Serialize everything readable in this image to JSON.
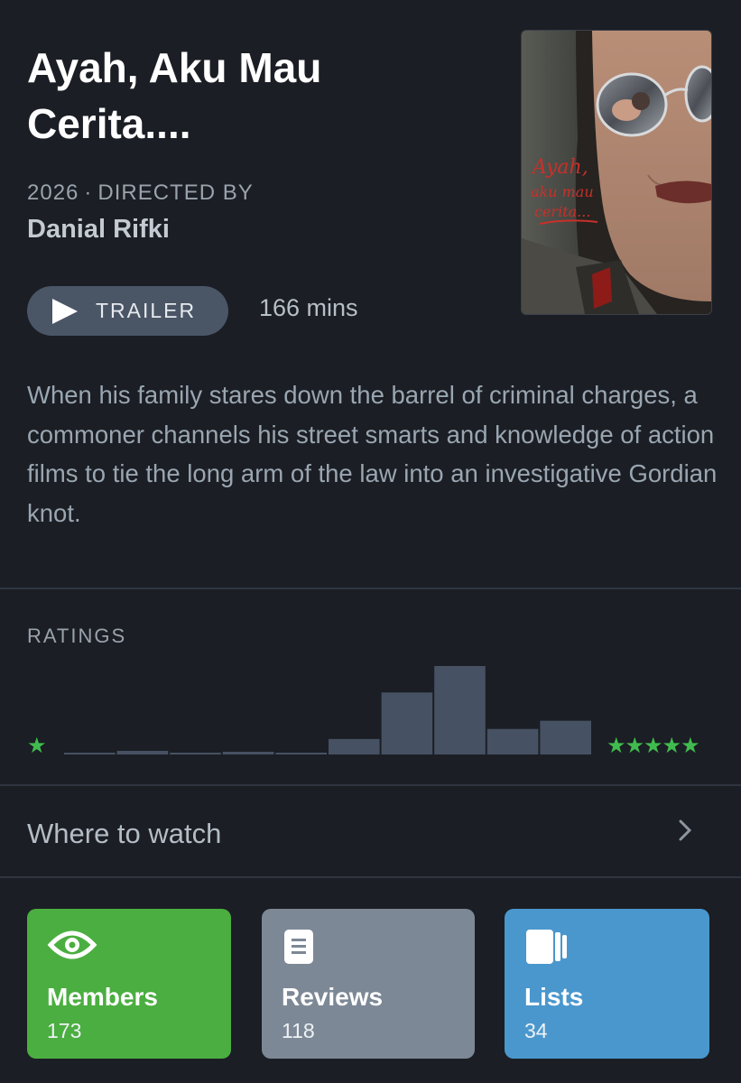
{
  "film": {
    "title": "Ayah, Aku Mau Cerita....",
    "year": "2026",
    "directed_by_label": "DIRECTED BY",
    "director": "Danial Rifki",
    "trailer_label": "TRAILER",
    "runtime": "166 mins",
    "synopsis": "When his family stares down the barrel of criminal charges, a commoner channels his street smarts and knowledge of action films to tie the long arm of the law into an investigative Gordian knot.",
    "poster_text": [
      "Ayah,",
      "aku mau",
      "cerita..."
    ]
  },
  "ratings": {
    "label": "RATINGS",
    "low_label": "★",
    "high_label": "★★★★★",
    "bar_color": "#465263",
    "star_color": "#40bc4f",
    "bins": [
      0.5,
      1,
      1.5,
      2,
      2.5,
      3,
      3.5,
      4,
      4.5,
      5
    ],
    "values": [
      1,
      4,
      1,
      3,
      2,
      17,
      68,
      97,
      28,
      37
    ]
  },
  "where_to_watch": {
    "label": "Where to watch"
  },
  "stats": [
    {
      "label": "Members",
      "count": "173",
      "icon": "eye-icon",
      "color": "#4bae40"
    },
    {
      "label": "Reviews",
      "count": "118",
      "icon": "document-icon",
      "color": "#7d8896"
    },
    {
      "label": "Lists",
      "count": "34",
      "icon": "lists-icon",
      "color": "#4a97cd"
    }
  ]
}
